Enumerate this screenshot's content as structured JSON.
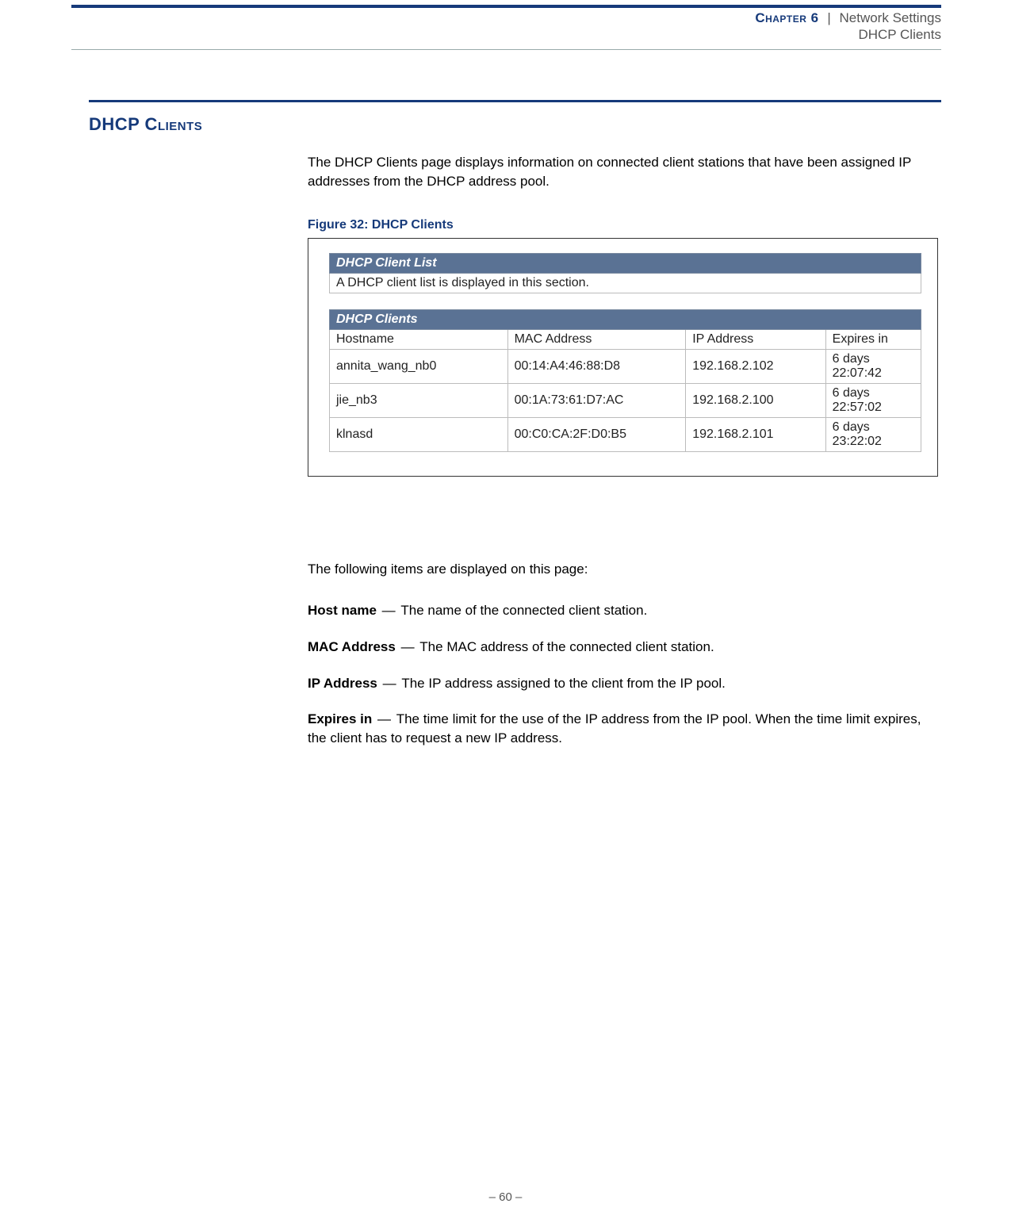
{
  "header": {
    "chapter_label": "Chapter 6",
    "separator": "|",
    "section": "Network Settings",
    "subsection": "DHCP Clients"
  },
  "section_heading": "DHCP Clients",
  "intro_text": "The DHCP Clients page displays information on connected client stations that have been assigned IP addresses from the DHCP address pool.",
  "figure_caption": "Figure 32:  DHCP Clients",
  "figure": {
    "panel1_title": "DHCP Client List",
    "panel1_desc": "A DHCP client list is displayed in this section.",
    "panel2_title": "DHCP Clients",
    "columns": {
      "hostname": "Hostname",
      "mac": "MAC Address",
      "ip": "IP Address",
      "expires": "Expires in"
    },
    "rows": [
      {
        "hostname": "annita_wang_nb0",
        "mac": "00:14:A4:46:88:D8",
        "ip": "192.168.2.102",
        "expires": "6 days 22:07:42"
      },
      {
        "hostname": "jie_nb3",
        "mac": "00:1A:73:61:D7:AC",
        "ip": "192.168.2.100",
        "expires": "6 days 22:57:02"
      },
      {
        "hostname": "klnasd",
        "mac": "00:C0:CA:2F:D0:B5",
        "ip": "192.168.2.101",
        "expires": "6 days 23:22:02"
      }
    ]
  },
  "outro_text": "The following items are displayed on this page:",
  "definitions": [
    {
      "term": "Host name",
      "desc": "The name of the connected client station."
    },
    {
      "term": "MAC Address",
      "desc": "The MAC address of the connected client station."
    },
    {
      "term": "IP Address",
      "desc": "The IP address assigned to the client from the IP pool."
    },
    {
      "term": "Expires in",
      "desc": "The time limit for the use of the IP address from the IP pool. When the time limit expires, the client has to request a new IP address."
    }
  ],
  "page_number": "–  60  –"
}
